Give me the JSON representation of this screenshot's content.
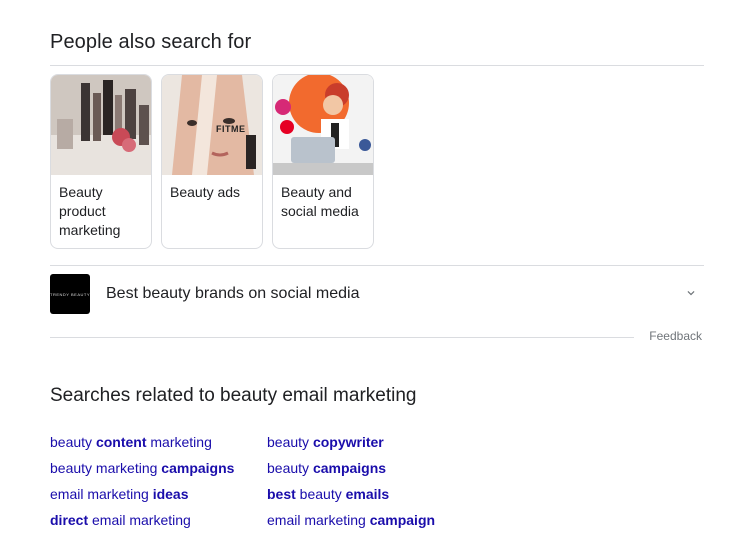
{
  "people_also_search": {
    "title": "People also search for",
    "cards": [
      {
        "label": "Beauty product marketing",
        "icon": "cosmetics-brushes-image"
      },
      {
        "label": "Beauty ads",
        "icon": "woman-face-ad-image",
        "overlay": "FITME"
      },
      {
        "label": "Beauty and social media",
        "icon": "cartoon-woman-social-image"
      }
    ],
    "expand_item": {
      "label": "Best beauty brands on social media",
      "logo_text": "TRENDY BEAUTY"
    },
    "feedback_label": "Feedback"
  },
  "related_searches": {
    "title": "Searches related to beauty email marketing",
    "left": [
      {
        "pre": "beauty ",
        "bold": "content",
        "post": " marketing"
      },
      {
        "pre": "beauty marketing ",
        "bold": "campaigns",
        "post": ""
      },
      {
        "pre": "email marketing ",
        "bold": "ideas",
        "post": ""
      },
      {
        "pre": "",
        "bold": "direct",
        "post": " email marketing"
      }
    ],
    "right": [
      {
        "pre": "beauty ",
        "bold": "copywriter",
        "post": ""
      },
      {
        "pre": "beauty ",
        "bold": "campaigns",
        "post": ""
      },
      {
        "pre": "",
        "bold": "best",
        "post": " beauty ",
        "bold2": "emails"
      },
      {
        "pre": "email marketing ",
        "bold": "campaign",
        "post": ""
      }
    ]
  }
}
